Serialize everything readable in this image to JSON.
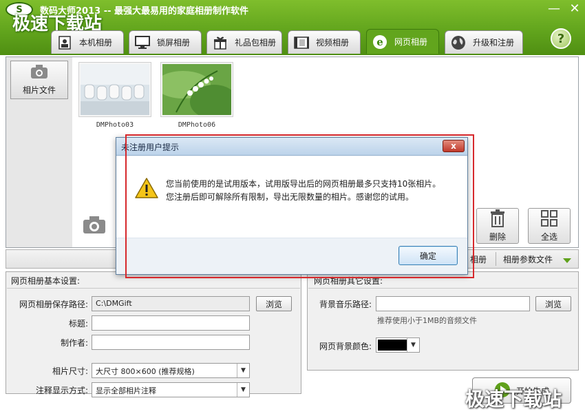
{
  "app": {
    "logo_text": "S",
    "title": "数码大师2013 -- 最强大最易用的家庭相册制作软件",
    "watermark": "极速下载站",
    "minimize_glyph": "—",
    "close_glyph": "✕"
  },
  "tabs": [
    {
      "label": "本机相册",
      "icon": "photo-book-icon"
    },
    {
      "label": "锁屏相册",
      "icon": "monitor-icon"
    },
    {
      "label": "礼品包相册",
      "icon": "gift-icon"
    },
    {
      "label": "视频相册",
      "icon": "film-icon"
    },
    {
      "label": "网页相册",
      "icon": "ie-icon",
      "active": true
    },
    {
      "label": "升级和注册",
      "icon": "globe-icon"
    }
  ],
  "help_glyph": "?",
  "left_panel": {
    "photo_file_button": "相片文件"
  },
  "photos": [
    {
      "caption": "DMPhoto03"
    },
    {
      "caption": "DMPhoto06"
    }
  ],
  "actions": {
    "delete": "删除",
    "select_all": "全选"
  },
  "strip": {
    "album_label": "相册",
    "album_params": "相册参数文件"
  },
  "basic_settings": {
    "heading": "网页相册基本设置:",
    "save_path_label": "网页相册保存路径:",
    "save_path_value": "C:\\DMGift",
    "browse": "浏览",
    "title_label": "标题:",
    "title_value": "",
    "author_label": "制作者:",
    "author_value": "",
    "size_label": "相片尺寸:",
    "size_value": "大尺寸 800×600 (推荐规格)",
    "caption_mode_label": "注释显示方式:",
    "caption_mode_value": "显示全部相片注释"
  },
  "other_settings": {
    "heading": "网页相册其它设置:",
    "music_label": "背景音乐路径:",
    "music_value": "",
    "browse": "浏览",
    "music_hint": "推荐使用小于1MB的音频文件",
    "bg_color_label": "网页背景颜色:",
    "bg_color": "#000000"
  },
  "start_button": "开始生成",
  "dialog": {
    "title": "未注册用户提示",
    "close": "x",
    "message": "您当前使用的是试用版本，试用版导出后的网页相册最多只支持10张相片。您注册后即可解除所有限制，导出无限数量的相片。感谢您的试用。",
    "ok": "确定"
  },
  "colors": {
    "brand_green": "#62a51d",
    "highlight_red": "#d6282c"
  }
}
